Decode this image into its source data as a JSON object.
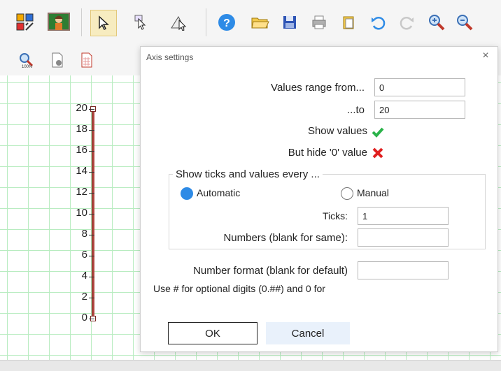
{
  "toolbar": {
    "icons": [
      "app-grid-icon",
      "teacher-icon",
      "select-pointer-icon",
      "point-select-icon",
      "shape-select-icon",
      "help-icon",
      "open-folder-icon",
      "save-icon",
      "print-icon",
      "paste-icon",
      "undo-icon",
      "redo-icon",
      "zoom-in-icon",
      "zoom-out-icon"
    ],
    "secondary_icons": [
      "zoom-fit-icon",
      "page-settings-icon",
      "grid-settings-icon"
    ]
  },
  "axis": {
    "tick_labels": [
      "20",
      "18",
      "16",
      "14",
      "12",
      "10",
      "8",
      "6",
      "4",
      "2",
      "0"
    ],
    "color": "#b0473f"
  },
  "dialog": {
    "title": "Axis settings",
    "close_label": "×",
    "range_from_label": "Values range from...",
    "range_from_value": "0",
    "range_to_label": "...to",
    "range_to_value": "20",
    "show_values_label": "Show values",
    "hide_zero_label": "But hide '0' value",
    "ticks_group_label": "Show ticks and values every ...",
    "automatic_label": "Automatic",
    "manual_label": "Manual",
    "ticks_label": "Ticks:",
    "ticks_value": "1",
    "numbers_label": "Numbers (blank for same):",
    "numbers_value": "",
    "number_format_label": "Number format (blank for default)",
    "number_format_value": "",
    "format_hint": "Use # for optional digits (0.##) and 0 for",
    "ok_label": "OK",
    "cancel_label": "Cancel"
  },
  "colors": {
    "accent": "#2e8be6",
    "check": "#2bb34a",
    "cross": "#e02020",
    "grid": "#b8ecc0"
  }
}
